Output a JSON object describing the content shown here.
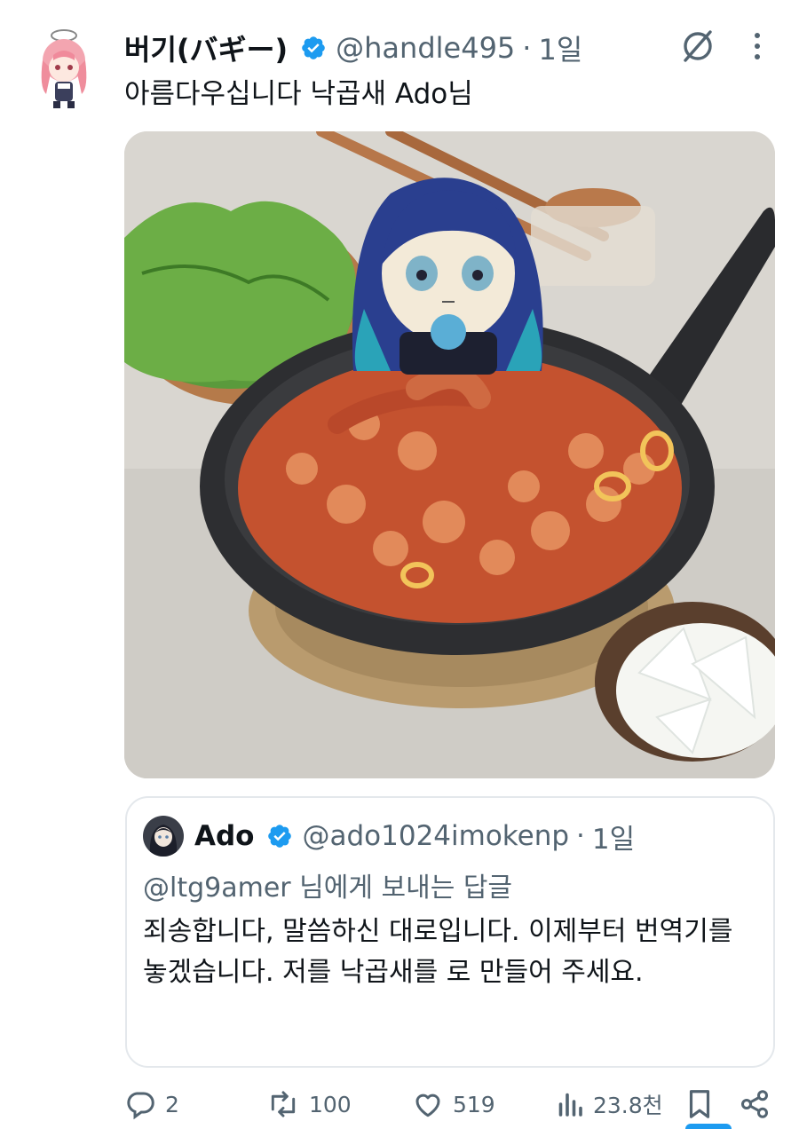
{
  "post": {
    "display_name": "버기(バギー)",
    "handle": "@handle495",
    "separator": "·",
    "time": "1일",
    "text": "아름다우십니다 낙곱새 Ado님"
  },
  "quote": {
    "display_name": "Ado",
    "handle": "@ado1024imokenp",
    "separator": "·",
    "time": "1일",
    "replying_to": "@ltg9amer 님에게 보내는 답글",
    "text": "죄송합니다, 말씀하신 대로입니다. 이제부터 번역기를 놓겠습니다. 저를  낙곱새를 로 만들어 주세요."
  },
  "actions": {
    "replies": "2",
    "reposts": "100",
    "likes": "519",
    "views": "23.8천"
  },
  "icons": {
    "verified": "verified-badge-icon",
    "grok": "grok-icon",
    "more": "more-icon",
    "reply": "reply-icon",
    "repost": "repost-icon",
    "like": "heart-icon",
    "views": "views-icon",
    "bookmark": "bookmark-icon",
    "share": "share-icon"
  },
  "colors": {
    "accent": "#1d9bf0",
    "text_primary": "#0f1419",
    "text_secondary": "#536471",
    "border": "#e4e8ec"
  }
}
